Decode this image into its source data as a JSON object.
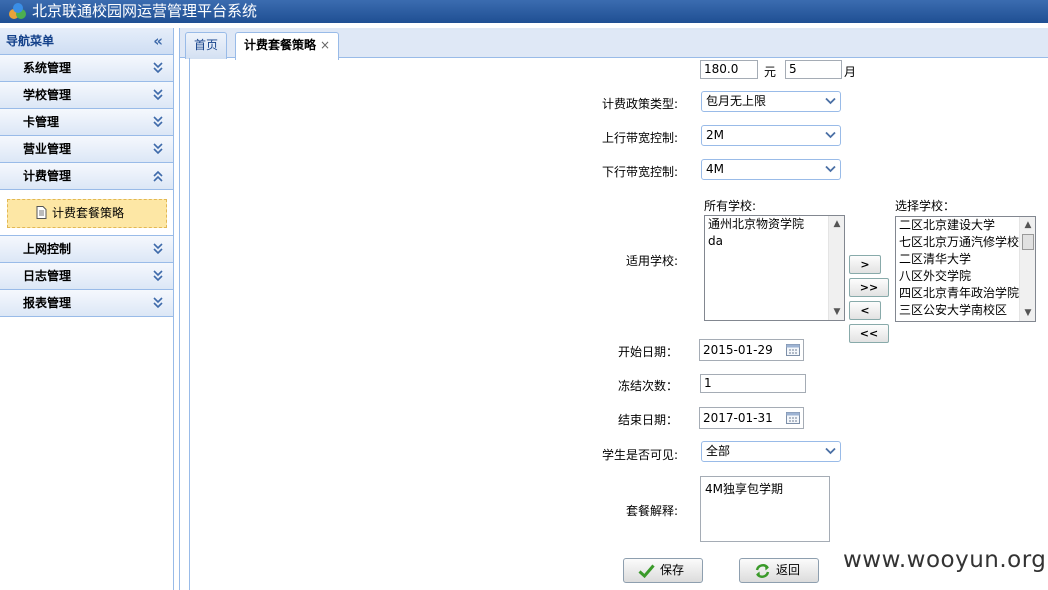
{
  "app": {
    "title": "北京联通校园网运营管理平台系统"
  },
  "sidebar": {
    "header": "导航菜单",
    "items_top": [
      {
        "label": "系统管理"
      },
      {
        "label": "学校管理"
      },
      {
        "label": "卡管理"
      },
      {
        "label": "营业管理"
      },
      {
        "label": "计费管理"
      }
    ],
    "sub_item": {
      "label": "计费套餐策略"
    },
    "items_bottom": [
      {
        "label": "上网控制"
      },
      {
        "label": "日志管理"
      },
      {
        "label": "报表管理"
      }
    ]
  },
  "tabs": [
    {
      "label": "首页"
    },
    {
      "label": "计费套餐策略",
      "close": "×"
    }
  ],
  "form": {
    "price": {
      "value": "180.0",
      "unit": "元"
    },
    "months": {
      "value": "5",
      "unit": "月"
    },
    "policy_type": {
      "label": "计费政策类型:",
      "value": "包月无上限"
    },
    "upload_bw": {
      "label": "上行带宽控制:",
      "value": "2M"
    },
    "download_bw": {
      "label": "下行带宽控制:",
      "value": "4M"
    },
    "schools": {
      "label": "适用学校:",
      "all_label": "所有学校:",
      "selected_label": "选择学校：",
      "all": [
        "通州北京物资学院",
        "da"
      ],
      "selected": [
        "二区北京建设大学",
        "七区北京万通汽修学校",
        "二区清华大学",
        "八区外交学院",
        "四区北京青年政治学院",
        "三区公安大学南校区"
      ],
      "buttons": [
        ">",
        ">>",
        "<",
        "<<"
      ]
    },
    "start_date": {
      "label": "开始日期：",
      "value": "2015-01-29"
    },
    "freeze_count": {
      "label": "冻结次数：",
      "value": "1"
    },
    "end_date": {
      "label": "结束日期：",
      "value": "2017-01-31"
    },
    "student_visible": {
      "label": "学生是否可见:",
      "value": "全部"
    },
    "description": {
      "label": "套餐解释:",
      "value": "4M独享包学期"
    },
    "save_button": "保存",
    "back_button": "返回"
  },
  "watermark": "www.wooyun.org",
  "colors": {
    "title_bar": "#2a5ca0",
    "border": "#99bbe8",
    "selected_menu": "#fde7a5"
  }
}
